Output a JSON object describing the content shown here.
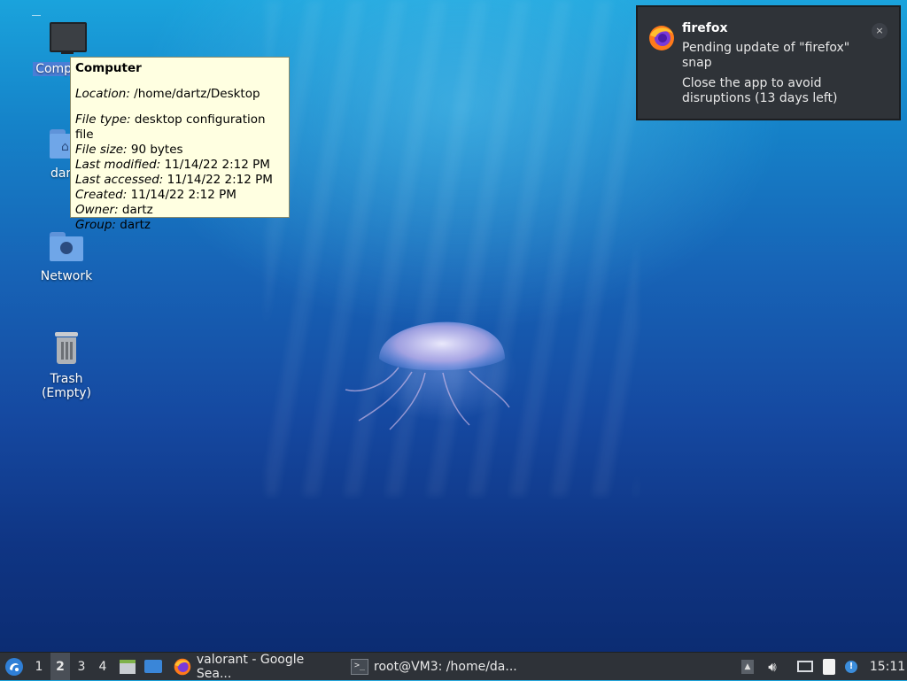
{
  "desktop": {
    "icons": [
      {
        "label": "Computer",
        "icon": "computer-icon"
      },
      {
        "label": "dartz",
        "icon": "home-folder-icon"
      },
      {
        "label": "Network",
        "icon": "network-folder-icon"
      },
      {
        "label": "Trash (Empty)",
        "icon": "trash-icon"
      }
    ]
  },
  "tooltip": {
    "title": "Computer",
    "location_key": "Location:",
    "location_val": " /home/dartz/Desktop",
    "type_key": "File type:",
    "type_val": " desktop configuration file",
    "size_key": "File size:",
    "size_val": " 90 bytes",
    "modified_key": "Last modified:",
    "modified_val": " 11/14/22 2:12 PM",
    "accessed_key": "Last accessed:",
    "accessed_val": " 11/14/22 2:12 PM",
    "created_key": "Created:",
    "created_val": " 11/14/22 2:12 PM",
    "owner_key": "Owner:",
    "owner_val": " dartz",
    "group_key": "Group:",
    "group_val": " dartz"
  },
  "notification": {
    "app": "firefox",
    "line1": "Pending update of \"firefox\" snap",
    "line2": "Close the app to avoid disruptions (13 days left)",
    "close": "×"
  },
  "taskbar": {
    "workspaces": [
      "1",
      "2",
      "3",
      "4"
    ],
    "active_workspace": "2",
    "tasks": [
      {
        "label": "valorant - Google Sea...",
        "icon": "firefox-icon"
      },
      {
        "label": "root@VM3: /home/da...",
        "icon": "terminal-icon"
      }
    ],
    "clock": "15:11"
  }
}
